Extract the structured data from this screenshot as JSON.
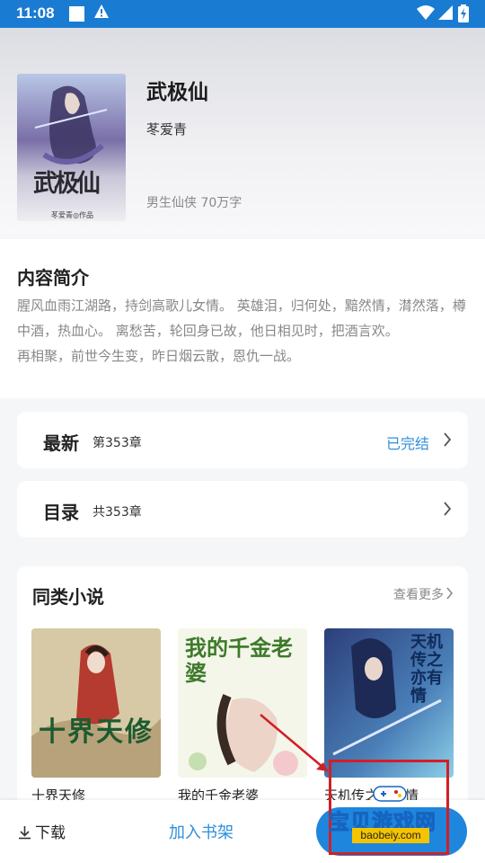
{
  "status_bar": {
    "time": "11:08"
  },
  "book": {
    "title": "武极仙",
    "author": "苳爱青",
    "meta": "男生仙侠 70万字",
    "cover_text": "武极仙",
    "cover_credit": "苳爱青◎作品"
  },
  "intro": {
    "title": "内容简介",
    "text": "腥风血雨江湖路，持剑高歌儿女情。 英雄泪，归何处，黯然情，潸然落，樽中酒，热血心。 离愁苦，轮回身已故，他日相见时，把酒言欢。\n再相聚，前世今生变，昨日烟云散，恩仇一战。"
  },
  "latest": {
    "label": "最新",
    "chapter": "第353章",
    "status": "已完结"
  },
  "catalog": {
    "label": "目录",
    "count": "共353章"
  },
  "similar": {
    "title": "同类小说",
    "more": "查看更多",
    "items": [
      {
        "name": "十界天修",
        "cover_text": "十界天修"
      },
      {
        "name": "我的千金老婆",
        "cover_text": "我的千金老婆"
      },
      {
        "name": "天机传之亦有情",
        "cover_text": "天机传之亦有情"
      }
    ]
  },
  "bottom": {
    "download": "下载",
    "add_shelf": "加入书架"
  },
  "watermark": {
    "text": "宝贝游戏网",
    "url": "baobeiy.com"
  },
  "colors": {
    "accent": "#1f86dd",
    "status_bar": "#1a7bd3",
    "link": "#2f8fdc",
    "watermark_frame": "#d21f26"
  }
}
